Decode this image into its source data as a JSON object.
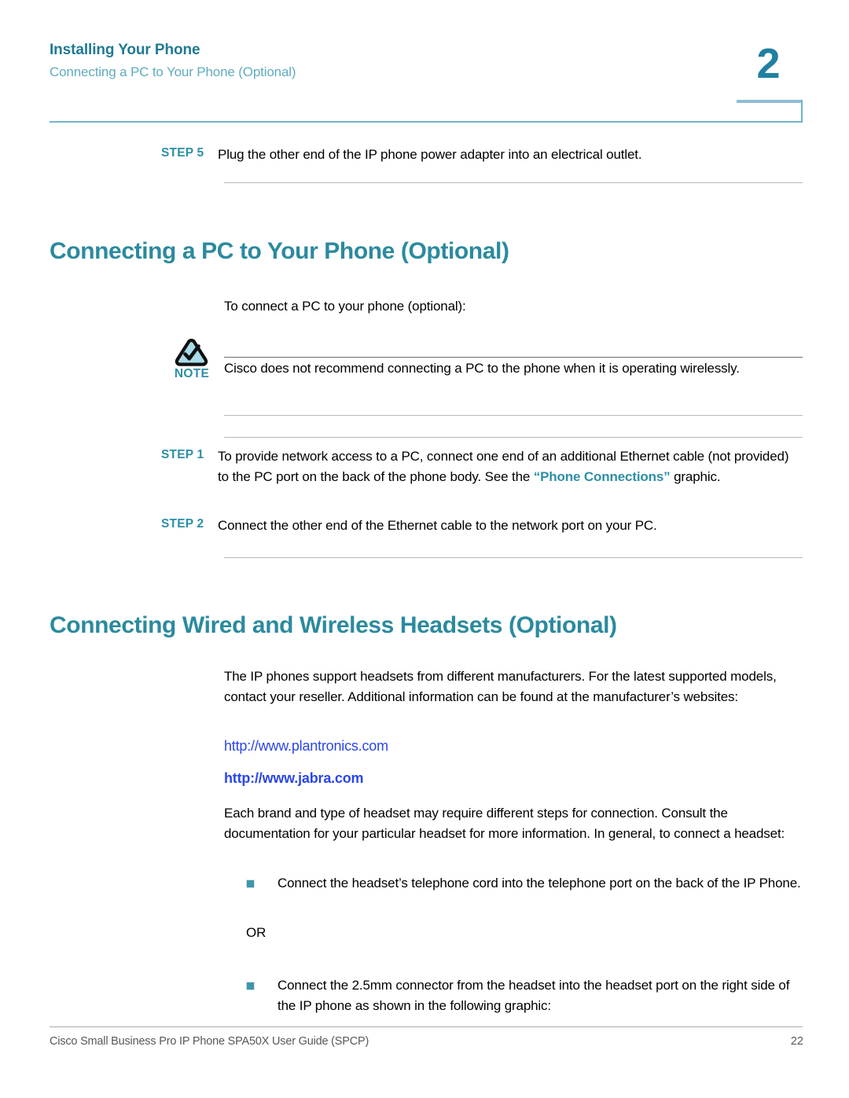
{
  "header": {
    "title": "Installing Your Phone",
    "subtitle": "Connecting a PC to Your Phone (Optional)",
    "chapter_number": "2",
    "accent_color": "#2b8a9e",
    "subtitle_color": "#5fabbe"
  },
  "top_step": {
    "label": "STEP 5",
    "text": "Plug the other end of the IP phone power adapter into an electrical outlet."
  },
  "section_pc": {
    "heading": "Connecting a PC to Your Phone (Optional)",
    "intro": "To connect a PC to your phone (optional):",
    "note": {
      "icon": "note-triangle-check-icon",
      "label": "NOTE",
      "text": "Cisco does not recommend connecting a PC to the phone when it is operating wirelessly."
    },
    "steps": [
      {
        "label": "STEP 1",
        "text_part1": "To provide network access to a PC, connect one end of an additional Ethernet cable (not provided) to the PC port on the back of the phone body. See the ",
        "text_link": "“Phone Connections”",
        "text_part2": " graphic."
      },
      {
        "label": "STEP 2",
        "text": "Connect the other end of the Ethernet cable to the network port on your PC."
      }
    ]
  },
  "section_headsets": {
    "heading": "Connecting Wired and Wireless Headsets (Optional)",
    "intro": "The IP phones support headsets from different manufacturers. For the latest supported models, contact your reseller. Additional information can be found at the manufacturer’s websites:",
    "links": [
      {
        "text": "http://www.plantronics.com",
        "bold": false,
        "color": "#2b46e8"
      },
      {
        "text": "http://www.jabra.com",
        "bold": true,
        "color": "#2b46e8"
      }
    ],
    "body": "Each brand and type of headset may require different steps for connection. Consult the documentation for your particular headset for more information. In general, to connect a headset:",
    "bullets": [
      "Connect the headset’s telephone cord into the telephone port on the back of the IP Phone.",
      "Connect the 2.5mm connector from the headset into the headset port on the right side of the IP phone as shown in the following graphic:"
    ],
    "or_text": "OR"
  },
  "footer": {
    "text": "Cisco Small Business Pro IP Phone SPA50X User Guide (SPCP)",
    "page_number": "22"
  }
}
